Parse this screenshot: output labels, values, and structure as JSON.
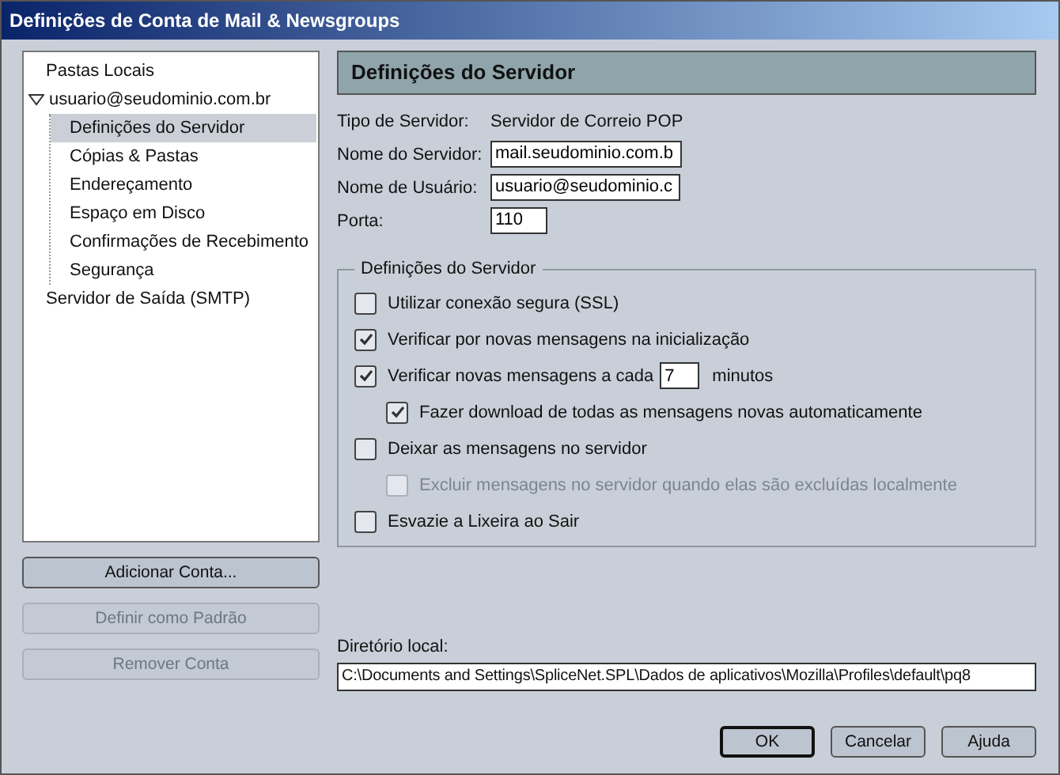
{
  "window": {
    "title": "Definições de Conta de Mail & Newsgroups"
  },
  "tree": [
    {
      "label": "Pastas Locais",
      "selected": false
    },
    {
      "label": "usuario@seudominio.com.br",
      "selected": false,
      "expanded": true,
      "children": [
        {
          "label": "Definições do Servidor",
          "selected": true
        },
        {
          "label": "Cópias & Pastas",
          "selected": false
        },
        {
          "label": "Endereçamento",
          "selected": false
        },
        {
          "label": "Espaço em Disco",
          "selected": false
        },
        {
          "label": "Confirmações de Recebimento",
          "selected": false
        },
        {
          "label": "Segurança",
          "selected": false
        }
      ]
    },
    {
      "label": "Servidor de Saída (SMTP)",
      "selected": false
    }
  ],
  "account_buttons": [
    {
      "label": "Adicionar Conta...",
      "disabled": false
    },
    {
      "label": "Definir como Padrão",
      "disabled": true
    },
    {
      "label": "Remover Conta",
      "disabled": true
    }
  ],
  "panel": {
    "title": "Definições do Servidor",
    "server_type": {
      "label": "Tipo de Servidor:",
      "value": "Servidor de Correio POP"
    },
    "fields": [
      {
        "label": "Nome do Servidor:",
        "value": "mail.seudominio.com.b"
      },
      {
        "label": "Nome de Usuário:",
        "value": "usuario@seudominio.c"
      },
      {
        "label": "Porta:",
        "value": "110"
      }
    ],
    "group": {
      "title": "Definições do Servidor",
      "options": [
        {
          "kind": "checkbox",
          "label": "Utilizar conexão segura (SSL)",
          "checked": false,
          "disabled": false
        },
        {
          "kind": "checkbox",
          "label": "Verificar por novas mensagens na inicialização",
          "checked": true,
          "disabled": false
        },
        {
          "kind": "interval",
          "label": "Verificar novas mensagens a cada",
          "value": "7",
          "suffix": "minutos",
          "checked": true,
          "disabled": false,
          "children": [
            {
              "kind": "checkbox",
              "label": "Fazer download de todas as mensagens novas automaticamente",
              "checked": true,
              "disabled": false
            }
          ]
        },
        {
          "kind": "checkbox",
          "label": "Deixar as mensagens no servidor",
          "checked": false,
          "disabled": false,
          "children": [
            {
              "kind": "checkbox",
              "label": "Excluir mensagens no servidor quando elas são excluídas localmente",
              "checked": false,
              "disabled": true
            }
          ]
        },
        {
          "kind": "checkbox",
          "label": "Esvazie a Lixeira ao Sair",
          "checked": false,
          "disabled": false
        }
      ]
    },
    "local_dir": {
      "label": "Diretório local:",
      "value": "C:\\Documents and Settings\\SpliceNet.SPL\\Dados de aplicativos\\Mozilla\\Profiles\\default\\pq8"
    }
  },
  "dialog_buttons": [
    {
      "label": "OK",
      "default": true
    },
    {
      "label": "Cancelar",
      "default": false
    },
    {
      "label": "Ajuda",
      "default": false
    }
  ]
}
